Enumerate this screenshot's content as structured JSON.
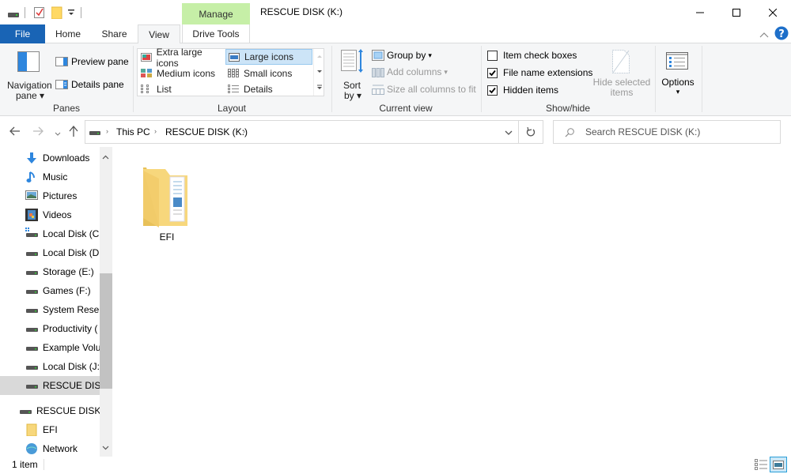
{
  "window": {
    "title": "RESCUE DISK (K:)",
    "context_tab": "Manage",
    "controls": {
      "minimize": "minimize",
      "maximize": "maximize",
      "close": "close"
    }
  },
  "quick_access": {
    "icons": [
      "drive-icon",
      "properties-icon",
      "new-folder-icon",
      "customize-qat-icon"
    ]
  },
  "tabs": [
    {
      "label": "File"
    },
    {
      "label": "Home"
    },
    {
      "label": "Share"
    },
    {
      "label": "View",
      "active": true
    },
    {
      "label": "Drive Tools"
    }
  ],
  "ribbon": {
    "panes": {
      "label": "Panes",
      "navigation_pane": "Navigation",
      "navigation_pane2": "pane",
      "preview_pane": "Preview pane",
      "details_pane": "Details pane"
    },
    "layout": {
      "label": "Layout",
      "items": [
        {
          "label": "Extra large icons",
          "selected": false
        },
        {
          "label": "Large icons",
          "selected": true
        },
        {
          "label": "Medium icons",
          "selected": false
        },
        {
          "label": "Small icons",
          "selected": false
        },
        {
          "label": "List",
          "selected": false
        },
        {
          "label": "Details",
          "selected": false
        }
      ]
    },
    "current_view": {
      "label": "Current view",
      "sort_by": "Sort",
      "sort_by2": "by",
      "group_by": "Group by",
      "add_columns": "Add columns",
      "size_columns": "Size all columns to fit"
    },
    "show_hide": {
      "label": "Show/hide",
      "item_check_boxes": {
        "label": "Item check boxes",
        "checked": false
      },
      "file_name_extensions": {
        "label": "File name extensions",
        "checked": true
      },
      "hidden_items": {
        "label": "Hidden items",
        "checked": true
      },
      "hide_selected": "Hide selected",
      "hide_selected2": "items"
    },
    "options": {
      "label": "Options"
    }
  },
  "address": {
    "breadcrumb": [
      "This PC",
      "RESCUE DISK (K:)"
    ],
    "search_placeholder": "Search RESCUE DISK (K:)"
  },
  "nav": {
    "items": [
      {
        "label": "Downloads",
        "icon": "downloads-icon"
      },
      {
        "label": "Music",
        "icon": "music-icon"
      },
      {
        "label": "Pictures",
        "icon": "pictures-icon"
      },
      {
        "label": "Videos",
        "icon": "videos-icon"
      },
      {
        "label": "Local Disk (C:)",
        "icon": "system-drive-icon"
      },
      {
        "label": "Local Disk (D:)",
        "icon": "drive-icon"
      },
      {
        "label": "Storage (E:)",
        "icon": "drive-icon"
      },
      {
        "label": "Games (F:)",
        "icon": "drive-icon"
      },
      {
        "label": "System Reserved",
        "icon": "drive-icon"
      },
      {
        "label": "Productivity (",
        "icon": "drive-icon"
      },
      {
        "label": "Example Volume",
        "icon": "drive-icon"
      },
      {
        "label": "Local Disk (J:)",
        "icon": "drive-icon"
      },
      {
        "label": "RESCUE DISK (K:)",
        "icon": "drive-icon",
        "selected": true
      }
    ],
    "tree": [
      {
        "label": "RESCUE DISK (K:)",
        "icon": "drive-icon"
      },
      {
        "label": "EFI",
        "icon": "folder-icon"
      },
      {
        "label": "Network",
        "icon": "network-icon"
      }
    ]
  },
  "content": {
    "items": [
      {
        "name": "EFI",
        "type": "folder"
      }
    ]
  },
  "status": {
    "count": "1 item"
  },
  "colors": {
    "file_tab": "#1964b5",
    "manage_tab": "#c6efa7",
    "selection": "#cce4f7",
    "accent": "#0078d7"
  }
}
